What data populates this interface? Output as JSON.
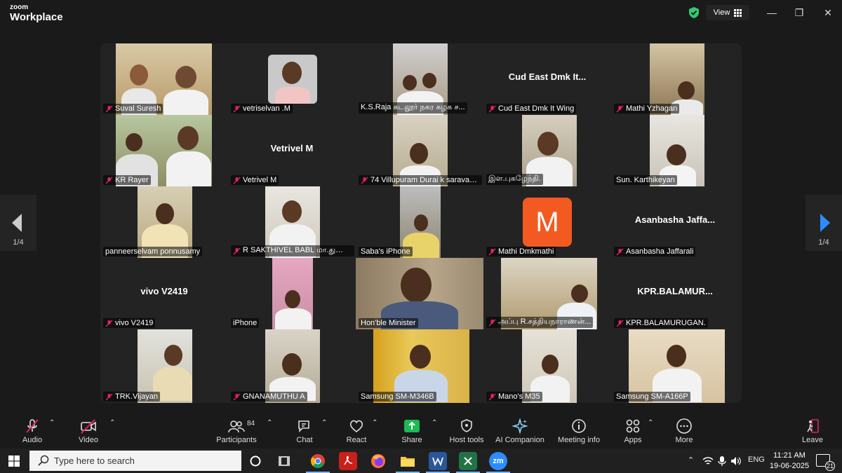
{
  "app": {
    "brand_top": "zoom",
    "brand_bottom": "Workplace"
  },
  "header": {
    "view_label": "View"
  },
  "pager": {
    "left_page": "1/4",
    "right_page": "1/4"
  },
  "tiles": [
    {
      "name": "Suval Suresh",
      "muted": true,
      "big_label": ""
    },
    {
      "name": "vetriselvan .M",
      "muted": true,
      "big_label": ""
    },
    {
      "name": "K.S.Raja கடலூர் நகர கழக ச...",
      "muted": false,
      "big_label": ""
    },
    {
      "name": "Cud East Dmk It Wing",
      "muted": true,
      "big_label": "Cud East Dmk It..."
    },
    {
      "name": "Mathi Yzhagan",
      "muted": true,
      "big_label": ""
    },
    {
      "name": "KR Rayer",
      "muted": true,
      "big_label": ""
    },
    {
      "name": "Vetrivel M",
      "muted": true,
      "big_label": "Vetrivel M"
    },
    {
      "name": "74 Villupuram Durai k saravan...",
      "muted": true,
      "big_label": ""
    },
    {
      "name": "இள.புகழேந்தி.",
      "muted": true,
      "big_label": ""
    },
    {
      "name": "Sun. Karthikeyan",
      "muted": false,
      "big_label": ""
    },
    {
      "name": "panneerselvam ponnusamy",
      "muted": false,
      "big_label": ""
    },
    {
      "name": "R SAKTHIVEL BABL மா.துணை",
      "muted": true,
      "big_label": ""
    },
    {
      "name": "Saba's iPhone",
      "muted": false,
      "big_label": ""
    },
    {
      "name": "Mathi Dmkmathi",
      "muted": true,
      "big_label": "",
      "avatar_letter": "M"
    },
    {
      "name": "Asanbasha Jaffarali",
      "muted": true,
      "big_label": "Asanbasha Jaffa..."
    },
    {
      "name": "vivo V2419",
      "muted": true,
      "big_label": "vivo V2419"
    },
    {
      "name": "iPhone",
      "muted": false,
      "big_label": ""
    },
    {
      "name": "Hon'ble Minister",
      "muted": false,
      "big_label": "",
      "active": true
    },
    {
      "name": "அப்பு R.சத்தியநாராணன்...",
      "muted": true,
      "big_label": ""
    },
    {
      "name": "KPR.BALAMURUGAN.",
      "muted": true,
      "big_label": "KPR.BALAMUR..."
    },
    {
      "name": "TRK.Vijayan",
      "muted": true,
      "big_label": ""
    },
    {
      "name": "GNANAMUTHU A",
      "muted": true,
      "big_label": ""
    },
    {
      "name": "Samsung SM-M346B",
      "muted": false,
      "big_label": ""
    },
    {
      "name": "Mano's M35",
      "muted": true,
      "big_label": ""
    },
    {
      "name": "Samsung SM-A166P",
      "muted": false,
      "big_label": ""
    }
  ],
  "toolbar": {
    "audio": "Audio",
    "video": "Video",
    "participants": "Participants",
    "participants_count": "84",
    "chat": "Chat",
    "react": "React",
    "share": "Share",
    "host_tools": "Host tools",
    "ai_companion": "AI Companion",
    "meeting_info": "Meeting info",
    "apps": "Apps",
    "more": "More",
    "leave": "Leave"
  },
  "taskbar": {
    "search_placeholder": "Type here to search",
    "lang": "ENG",
    "time": "11:21 AM",
    "date": "19-06-2025",
    "notifications": "21",
    "zoom_app_label": "zm"
  },
  "colors": {
    "accent_green": "#2ecc71",
    "share_green": "#1db954",
    "avatar_orange": "#f25a22",
    "pager_arrow": "#2d8cff"
  }
}
